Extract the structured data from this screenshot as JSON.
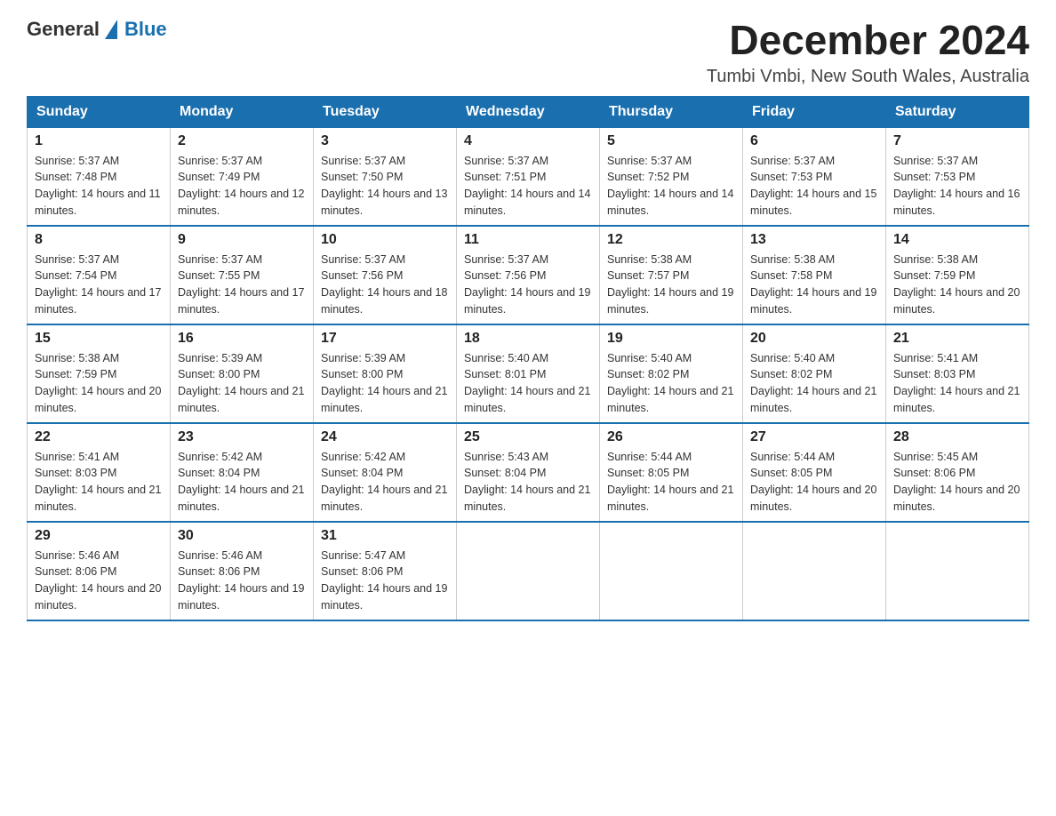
{
  "logo": {
    "general": "General",
    "blue": "Blue"
  },
  "title": "December 2024",
  "subtitle": "Tumbi Vmbi, New South Wales, Australia",
  "headers": [
    "Sunday",
    "Monday",
    "Tuesday",
    "Wednesday",
    "Thursday",
    "Friday",
    "Saturday"
  ],
  "weeks": [
    [
      {
        "day": "1",
        "sunrise": "5:37 AM",
        "sunset": "7:48 PM",
        "daylight": "14 hours and 11 minutes."
      },
      {
        "day": "2",
        "sunrise": "5:37 AM",
        "sunset": "7:49 PM",
        "daylight": "14 hours and 12 minutes."
      },
      {
        "day": "3",
        "sunrise": "5:37 AM",
        "sunset": "7:50 PM",
        "daylight": "14 hours and 13 minutes."
      },
      {
        "day": "4",
        "sunrise": "5:37 AM",
        "sunset": "7:51 PM",
        "daylight": "14 hours and 14 minutes."
      },
      {
        "day": "5",
        "sunrise": "5:37 AM",
        "sunset": "7:52 PM",
        "daylight": "14 hours and 14 minutes."
      },
      {
        "day": "6",
        "sunrise": "5:37 AM",
        "sunset": "7:53 PM",
        "daylight": "14 hours and 15 minutes."
      },
      {
        "day": "7",
        "sunrise": "5:37 AM",
        "sunset": "7:53 PM",
        "daylight": "14 hours and 16 minutes."
      }
    ],
    [
      {
        "day": "8",
        "sunrise": "5:37 AM",
        "sunset": "7:54 PM",
        "daylight": "14 hours and 17 minutes."
      },
      {
        "day": "9",
        "sunrise": "5:37 AM",
        "sunset": "7:55 PM",
        "daylight": "14 hours and 17 minutes."
      },
      {
        "day": "10",
        "sunrise": "5:37 AM",
        "sunset": "7:56 PM",
        "daylight": "14 hours and 18 minutes."
      },
      {
        "day": "11",
        "sunrise": "5:37 AM",
        "sunset": "7:56 PM",
        "daylight": "14 hours and 19 minutes."
      },
      {
        "day": "12",
        "sunrise": "5:38 AM",
        "sunset": "7:57 PM",
        "daylight": "14 hours and 19 minutes."
      },
      {
        "day": "13",
        "sunrise": "5:38 AM",
        "sunset": "7:58 PM",
        "daylight": "14 hours and 19 minutes."
      },
      {
        "day": "14",
        "sunrise": "5:38 AM",
        "sunset": "7:59 PM",
        "daylight": "14 hours and 20 minutes."
      }
    ],
    [
      {
        "day": "15",
        "sunrise": "5:38 AM",
        "sunset": "7:59 PM",
        "daylight": "14 hours and 20 minutes."
      },
      {
        "day": "16",
        "sunrise": "5:39 AM",
        "sunset": "8:00 PM",
        "daylight": "14 hours and 21 minutes."
      },
      {
        "day": "17",
        "sunrise": "5:39 AM",
        "sunset": "8:00 PM",
        "daylight": "14 hours and 21 minutes."
      },
      {
        "day": "18",
        "sunrise": "5:40 AM",
        "sunset": "8:01 PM",
        "daylight": "14 hours and 21 minutes."
      },
      {
        "day": "19",
        "sunrise": "5:40 AM",
        "sunset": "8:02 PM",
        "daylight": "14 hours and 21 minutes."
      },
      {
        "day": "20",
        "sunrise": "5:40 AM",
        "sunset": "8:02 PM",
        "daylight": "14 hours and 21 minutes."
      },
      {
        "day": "21",
        "sunrise": "5:41 AM",
        "sunset": "8:03 PM",
        "daylight": "14 hours and 21 minutes."
      }
    ],
    [
      {
        "day": "22",
        "sunrise": "5:41 AM",
        "sunset": "8:03 PM",
        "daylight": "14 hours and 21 minutes."
      },
      {
        "day": "23",
        "sunrise": "5:42 AM",
        "sunset": "8:04 PM",
        "daylight": "14 hours and 21 minutes."
      },
      {
        "day": "24",
        "sunrise": "5:42 AM",
        "sunset": "8:04 PM",
        "daylight": "14 hours and 21 minutes."
      },
      {
        "day": "25",
        "sunrise": "5:43 AM",
        "sunset": "8:04 PM",
        "daylight": "14 hours and 21 minutes."
      },
      {
        "day": "26",
        "sunrise": "5:44 AM",
        "sunset": "8:05 PM",
        "daylight": "14 hours and 21 minutes."
      },
      {
        "day": "27",
        "sunrise": "5:44 AM",
        "sunset": "8:05 PM",
        "daylight": "14 hours and 20 minutes."
      },
      {
        "day": "28",
        "sunrise": "5:45 AM",
        "sunset": "8:06 PM",
        "daylight": "14 hours and 20 minutes."
      }
    ],
    [
      {
        "day": "29",
        "sunrise": "5:46 AM",
        "sunset": "8:06 PM",
        "daylight": "14 hours and 20 minutes."
      },
      {
        "day": "30",
        "sunrise": "5:46 AM",
        "sunset": "8:06 PM",
        "daylight": "14 hours and 19 minutes."
      },
      {
        "day": "31",
        "sunrise": "5:47 AM",
        "sunset": "8:06 PM",
        "daylight": "14 hours and 19 minutes."
      },
      null,
      null,
      null,
      null
    ]
  ]
}
